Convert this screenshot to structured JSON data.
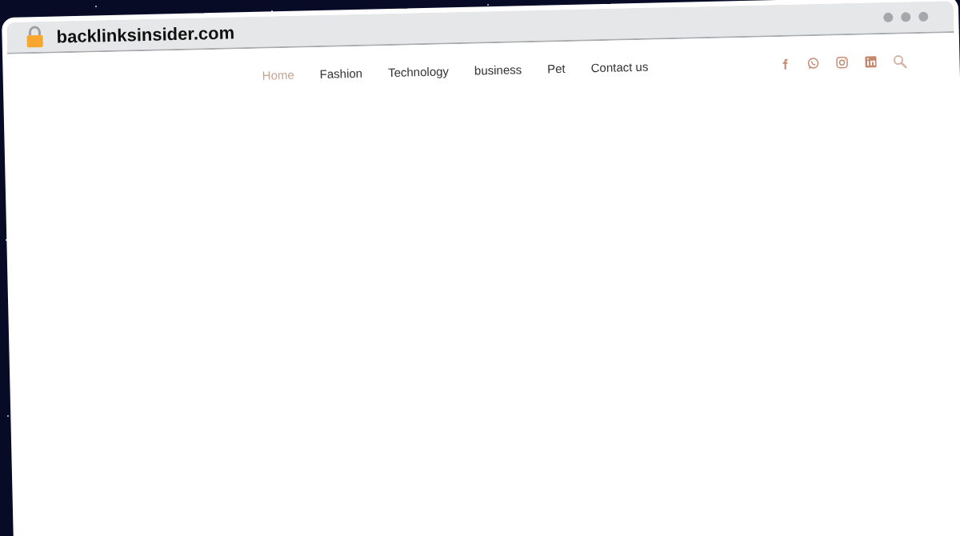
{
  "browser": {
    "address": "backlinksinsider.com"
  },
  "nav": [
    {
      "label": "Home",
      "selected": true
    },
    {
      "label": "Fashion",
      "selected": false
    },
    {
      "label": "Technology",
      "selected": false
    },
    {
      "label": "business",
      "selected": false
    },
    {
      "label": "Pet",
      "selected": false
    },
    {
      "label": "Contact us",
      "selected": false
    }
  ],
  "social": [
    {
      "kind": "facebook"
    },
    {
      "kind": "whatsapp"
    },
    {
      "kind": "instagram"
    },
    {
      "kind": "linkedin"
    },
    {
      "kind": "search"
    }
  ]
}
